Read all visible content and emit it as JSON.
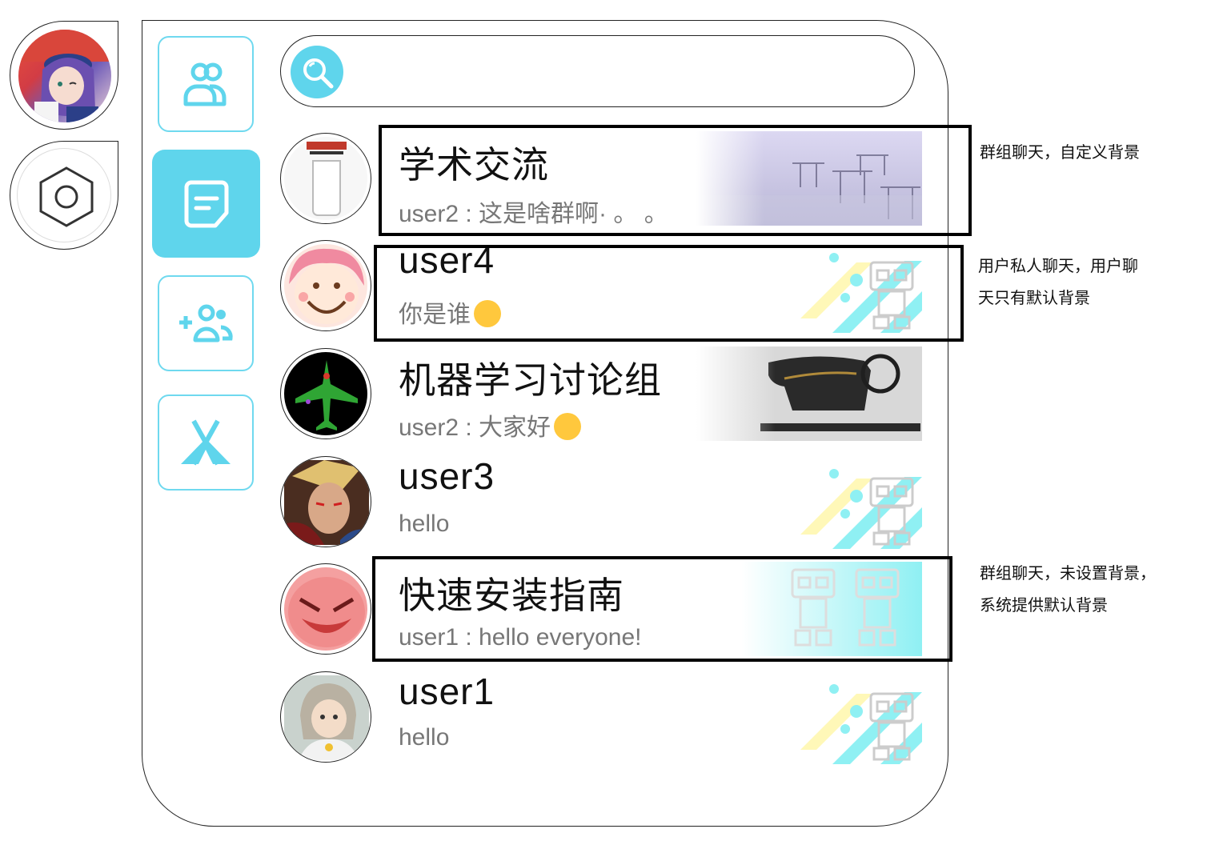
{
  "self": {
    "avatar_alt": "self avatar"
  },
  "nav": [
    {
      "id": "friends",
      "icon": "group-icon",
      "active": false
    },
    {
      "id": "chats",
      "icon": "chat-icon",
      "active": true
    },
    {
      "id": "add-friend",
      "icon": "add-user-icon",
      "active": false
    },
    {
      "id": "discover",
      "icon": "tent-icon",
      "active": false
    }
  ],
  "search": {
    "placeholder": "",
    "value": ""
  },
  "chats": [
    {
      "name": "学术交流",
      "message": "user2 : 这是啥群啊· 。 。",
      "type": "group",
      "background": "custom"
    },
    {
      "name": "user4",
      "message": "你是谁",
      "type": "private",
      "background": "default"
    },
    {
      "name": "机器学习讨论组",
      "message": "user2 : 大家好",
      "type": "group",
      "background": "custom"
    },
    {
      "name": "user3",
      "message": "hello",
      "type": "private",
      "background": "default"
    },
    {
      "name": "快速安装指南",
      "message": "user1 : hello everyone!",
      "type": "group",
      "background": "system-default"
    },
    {
      "name": "user1",
      "message": "hello",
      "type": "private",
      "background": "default"
    }
  ],
  "annotations": {
    "group_custom": "群组聊天，自定义背景",
    "private_line1": "用户私人聊天，用户聊",
    "private_line2": "天只有默认背景",
    "group_default_line1": "群组聊天，未设置背景，",
    "group_default_line2": "系统提供默认背景"
  },
  "colors": {
    "accent": "#5fd5ec",
    "border": "#222222",
    "message": "#777777"
  }
}
